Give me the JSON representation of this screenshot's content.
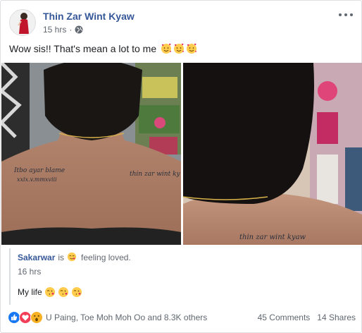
{
  "post": {
    "author": "Thin Zar Wint Kyaw",
    "time": "15 hrs",
    "separator": "·",
    "text": "Wow sis!! That's mean a lot to me",
    "text_emojis": [
      "smiling-face-with-hearts",
      "smiling-face-with-hearts",
      "smiling-face-with-hearts"
    ]
  },
  "photos": {
    "left_tattoo_line1": "Itbo ayar blame",
    "left_tattoo_line2": "xxix.v.mmxviii",
    "left_tattoo_right": "thin zar wint ky",
    "right_tattoo": "thin zar wint kyaw"
  },
  "shared": {
    "author": "Sakarwar",
    "is": "is",
    "feeling": "feeling loved.",
    "time": "16 hrs",
    "text": "My life",
    "text_emojis": [
      "face-blowing-kiss",
      "face-blowing-kiss",
      "face-blowing-kiss"
    ]
  },
  "footer": {
    "reactions": [
      "like",
      "love",
      "wow"
    ],
    "names": "U Paing, Toe Moh Moh Oo and 8.3K others",
    "comments": "45 Comments",
    "shares": "14 Shares"
  },
  "colors": {
    "link": "#365899",
    "meta": "#616770",
    "like": "#1877f2",
    "love": "#f33e58",
    "wow": "#f7b125"
  }
}
